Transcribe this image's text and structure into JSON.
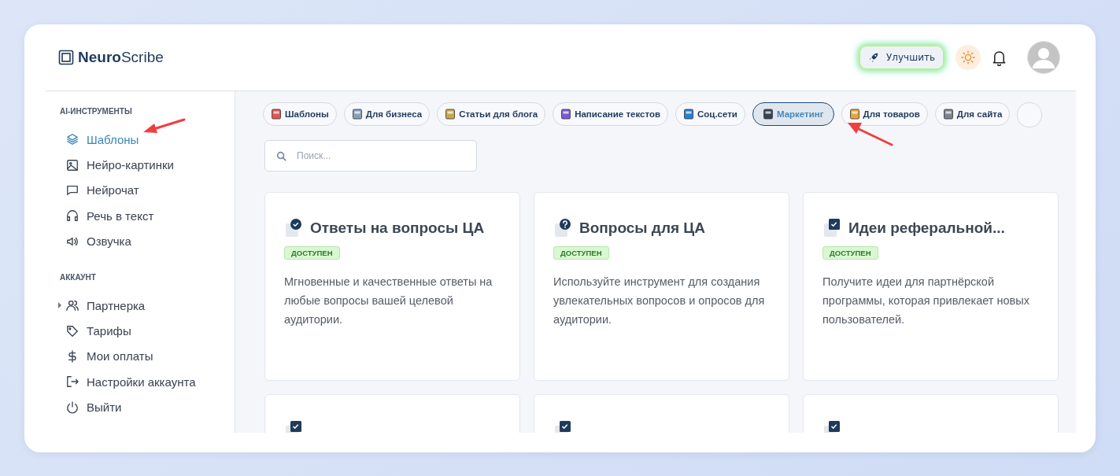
{
  "logo": {
    "bold": "Neuro",
    "light": "Scribe"
  },
  "header": {
    "upgrade_label": "Улучшить"
  },
  "sidebar": {
    "sections": [
      {
        "title": "AI-ИНСТРУМЕНТЫ",
        "items": [
          {
            "label": "Шаблоны",
            "selected": true,
            "expandable": false
          },
          {
            "label": "Нейро-картинки",
            "selected": false,
            "expandable": false
          },
          {
            "label": "Нейрочат",
            "selected": false,
            "expandable": false
          },
          {
            "label": "Речь в текст",
            "selected": false,
            "expandable": false
          },
          {
            "label": "Озвучка",
            "selected": false,
            "expandable": false
          }
        ]
      },
      {
        "title": "АККАУНТ",
        "items": [
          {
            "label": "Партнерка",
            "selected": false,
            "expandable": true
          },
          {
            "label": "Тарифы",
            "selected": false,
            "expandable": false
          },
          {
            "label": "Мои оплаты",
            "selected": false,
            "expandable": false
          },
          {
            "label": "Настройки аккаунта",
            "selected": false,
            "expandable": false
          },
          {
            "label": "Выйти",
            "selected": false,
            "expandable": false
          }
        ]
      }
    ]
  },
  "categories": [
    {
      "label": "Шаблоны",
      "selected": false
    },
    {
      "label": "Для бизнеса",
      "selected": false
    },
    {
      "label": "Статьи для блога",
      "selected": false
    },
    {
      "label": "Написание текстов",
      "selected": false
    },
    {
      "label": "Соц.сети",
      "selected": false
    },
    {
      "label": "Маркетинг",
      "selected": true
    },
    {
      "label": "Для товаров",
      "selected": false
    },
    {
      "label": "Для сайта",
      "selected": false
    }
  ],
  "search": {
    "placeholder": "Поиск..."
  },
  "cards": [
    {
      "title": "Ответы на вопросы ЦА",
      "kind": "check-circle",
      "badge": "ДОСТУПЕН",
      "description": "Мгновенные и качественные ответы на любые вопросы вашей целевой аудитории."
    },
    {
      "title": "Вопросы для ЦА",
      "kind": "question",
      "badge": "ДОСТУПЕН",
      "description": "Используйте инструмент для создания увлекательных вопросов и опросов для аудитории."
    },
    {
      "title": "Идеи реферальной...",
      "kind": "check-square",
      "badge": "ДОСТУПЕН",
      "description": "Получите идеи для партнёрской программы, которая привлекает новых пользователей."
    },
    {
      "kind": "check-square"
    },
    {
      "kind": "check-square"
    },
    {
      "kind": "check-square"
    }
  ]
}
